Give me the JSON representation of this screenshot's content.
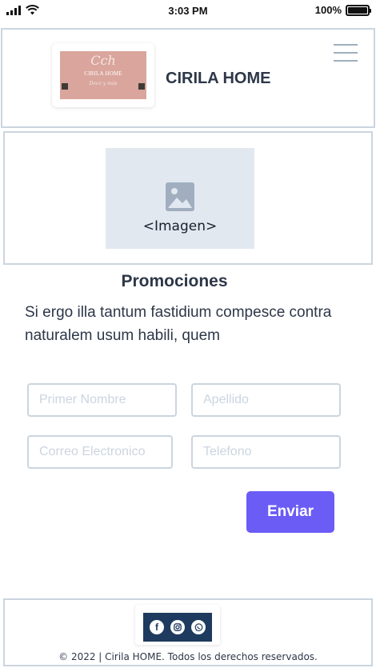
{
  "status_bar": {
    "time": "3:03 PM",
    "battery": "100%",
    "signal_icon": "signal-icon",
    "wifi_icon": "wifi-icon"
  },
  "header": {
    "logo": {
      "monogram": "Cch",
      "brand": "CIRILA HOME",
      "tagline": "Deco y más"
    },
    "title": "CIRILA HOME",
    "menu_icon": "hamburger-menu-icon"
  },
  "hero": {
    "placeholder_icon": "image-icon",
    "placeholder_label": "<Imagen>"
  },
  "promo": {
    "title": "Promociones",
    "text": "Si ergo illa tantum fastidium compesce contra naturalem usum habili, quem"
  },
  "form": {
    "first_name_placeholder": "Primer Nombre",
    "last_name_placeholder": "Apellido",
    "email_placeholder": "Correo Electronico",
    "phone_placeholder": "Telefono",
    "submit_label": "Enviar"
  },
  "footer": {
    "social": [
      {
        "name": "facebook",
        "icon": "facebook-icon",
        "glyph": "f"
      },
      {
        "name": "instagram",
        "icon": "instagram-icon"
      },
      {
        "name": "whatsapp",
        "icon": "whatsapp-icon"
      }
    ],
    "copyright": "© 2022 | Cirila HOME. Todos los derechos reservados."
  },
  "colors": {
    "accent": "#6b5cf6",
    "border": "#cbd5e0",
    "text": "#2d3748",
    "social_bg": "#1e3a5f",
    "logo_bg": "#d9a59c"
  }
}
